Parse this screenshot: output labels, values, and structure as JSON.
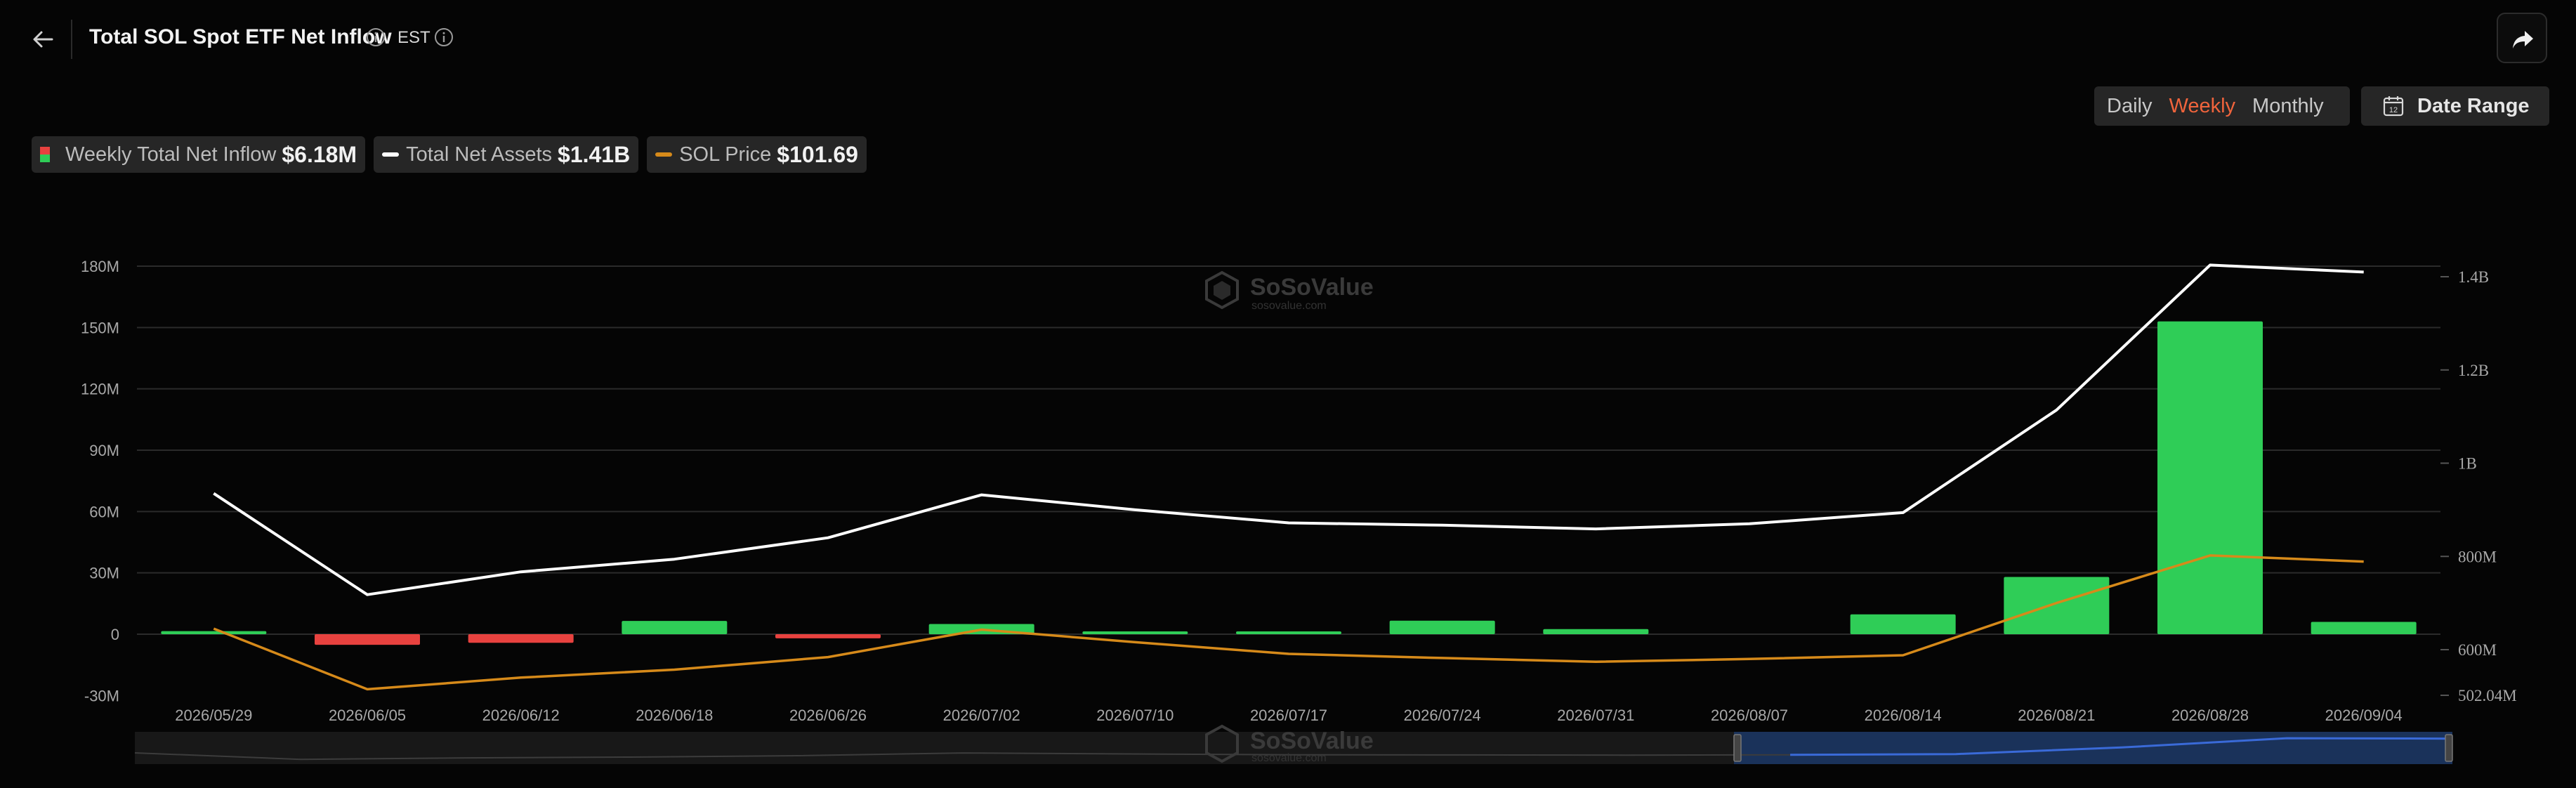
{
  "header": {
    "title": "Total SOL Spot ETF Net Inflow",
    "timezone": "EST"
  },
  "controls": {
    "periods": [
      "Daily",
      "Weekly",
      "Monthly"
    ],
    "active_period": "Weekly",
    "date_range_label": "Date Range",
    "date_range_day": "12"
  },
  "legend": [
    {
      "name": "Weekly Total Net Inflow",
      "value": "$6.18M"
    },
    {
      "name": "Total Net Assets",
      "value": "$1.41B"
    },
    {
      "name": "SOL Price",
      "value": "$101.69"
    }
  ],
  "watermark": {
    "brand": "SoSoValue",
    "domain": "sosovalue.com"
  },
  "colors": {
    "background": "#050505",
    "positive": "#2fcd57",
    "negative": "#e8423f",
    "assets_line": "#ffffff",
    "price_line": "#d68a1a",
    "active_period": "#f0643c",
    "navigator_selection": "#1b3766"
  },
  "chart_data": {
    "type": "bar",
    "categories": [
      "2026/05/29",
      "2026/06/05",
      "2026/06/12",
      "2026/06/18",
      "2026/06/26",
      "2026/07/02",
      "2026/07/10",
      "2026/07/17",
      "2026/07/24",
      "2026/07/31",
      "2026/08/07",
      "2026/08/14",
      "2026/08/21",
      "2026/08/28",
      "2026/09/04"
    ],
    "y_left": {
      "ticks": [
        -30,
        0,
        30,
        60,
        90,
        120,
        150,
        180
      ],
      "tick_labels": [
        "-30M",
        "0",
        "30M",
        "60M",
        "90M",
        "120M",
        "150M",
        "180M"
      ],
      "ylim": [
        -30,
        180
      ],
      "unit": "M USD"
    },
    "y_right": {
      "ticks": [
        502.04,
        600,
        800,
        1000,
        1200,
        1400
      ],
      "tick_labels": [
        "502.04M",
        "600M",
        "800M",
        "1B",
        "1.2B",
        "1.4B"
      ],
      "ylim": [
        502.04,
        1400
      ],
      "unit": "M USD"
    },
    "grid": true,
    "series": [
      {
        "name": "Weekly Total Net Inflow",
        "type": "bar",
        "axis": "left",
        "values": [
          1.5,
          -5.2,
          -4.2,
          6.5,
          -2.0,
          5.0,
          0.5,
          0.5,
          6.6,
          2.5,
          0,
          9.7,
          28.0,
          153.0,
          6.0
        ]
      },
      {
        "name": "Total Net Assets",
        "type": "line",
        "axis": "right",
        "values": [
          935,
          718,
          767,
          794,
          840,
          932,
          900,
          872,
          867,
          859,
          870,
          894,
          1114,
          1425,
          1410
        ]
      },
      {
        "name": "SOL Price",
        "type": "line",
        "axis": "right",
        "values": [
          645,
          515,
          540,
          557,
          584,
          643,
          616,
          591,
          582,
          574,
          580,
          588,
          700,
          802,
          789
        ]
      }
    ],
    "navigator": {
      "selection_start": 0.69,
      "selection_end": 1.0
    }
  }
}
